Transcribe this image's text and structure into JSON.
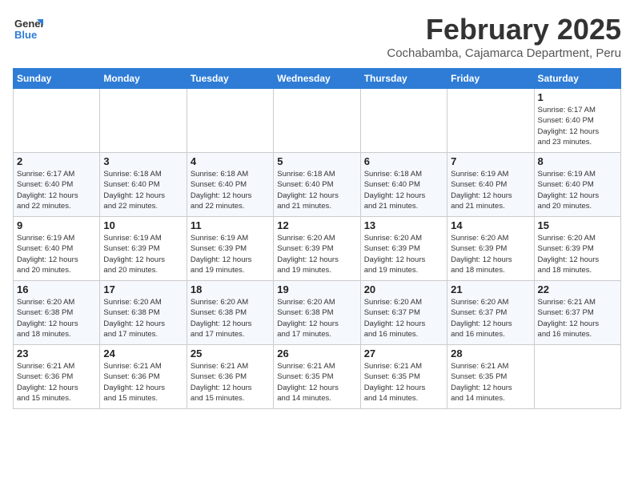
{
  "logo": {
    "general": "General",
    "blue": "Blue"
  },
  "header": {
    "title": "February 2025",
    "subtitle": "Cochabamba, Cajamarca Department, Peru"
  },
  "weekdays": [
    "Sunday",
    "Monday",
    "Tuesday",
    "Wednesday",
    "Thursday",
    "Friday",
    "Saturday"
  ],
  "weeks": [
    [
      {
        "day": "",
        "info": ""
      },
      {
        "day": "",
        "info": ""
      },
      {
        "day": "",
        "info": ""
      },
      {
        "day": "",
        "info": ""
      },
      {
        "day": "",
        "info": ""
      },
      {
        "day": "",
        "info": ""
      },
      {
        "day": "1",
        "info": "Sunrise: 6:17 AM\nSunset: 6:40 PM\nDaylight: 12 hours\nand 23 minutes."
      }
    ],
    [
      {
        "day": "2",
        "info": "Sunrise: 6:17 AM\nSunset: 6:40 PM\nDaylight: 12 hours\nand 22 minutes."
      },
      {
        "day": "3",
        "info": "Sunrise: 6:18 AM\nSunset: 6:40 PM\nDaylight: 12 hours\nand 22 minutes."
      },
      {
        "day": "4",
        "info": "Sunrise: 6:18 AM\nSunset: 6:40 PM\nDaylight: 12 hours\nand 22 minutes."
      },
      {
        "day": "5",
        "info": "Sunrise: 6:18 AM\nSunset: 6:40 PM\nDaylight: 12 hours\nand 21 minutes."
      },
      {
        "day": "6",
        "info": "Sunrise: 6:18 AM\nSunset: 6:40 PM\nDaylight: 12 hours\nand 21 minutes."
      },
      {
        "day": "7",
        "info": "Sunrise: 6:19 AM\nSunset: 6:40 PM\nDaylight: 12 hours\nand 21 minutes."
      },
      {
        "day": "8",
        "info": "Sunrise: 6:19 AM\nSunset: 6:40 PM\nDaylight: 12 hours\nand 20 minutes."
      }
    ],
    [
      {
        "day": "9",
        "info": "Sunrise: 6:19 AM\nSunset: 6:40 PM\nDaylight: 12 hours\nand 20 minutes."
      },
      {
        "day": "10",
        "info": "Sunrise: 6:19 AM\nSunset: 6:39 PM\nDaylight: 12 hours\nand 20 minutes."
      },
      {
        "day": "11",
        "info": "Sunrise: 6:19 AM\nSunset: 6:39 PM\nDaylight: 12 hours\nand 19 minutes."
      },
      {
        "day": "12",
        "info": "Sunrise: 6:20 AM\nSunset: 6:39 PM\nDaylight: 12 hours\nand 19 minutes."
      },
      {
        "day": "13",
        "info": "Sunrise: 6:20 AM\nSunset: 6:39 PM\nDaylight: 12 hours\nand 19 minutes."
      },
      {
        "day": "14",
        "info": "Sunrise: 6:20 AM\nSunset: 6:39 PM\nDaylight: 12 hours\nand 18 minutes."
      },
      {
        "day": "15",
        "info": "Sunrise: 6:20 AM\nSunset: 6:39 PM\nDaylight: 12 hours\nand 18 minutes."
      }
    ],
    [
      {
        "day": "16",
        "info": "Sunrise: 6:20 AM\nSunset: 6:38 PM\nDaylight: 12 hours\nand 18 minutes."
      },
      {
        "day": "17",
        "info": "Sunrise: 6:20 AM\nSunset: 6:38 PM\nDaylight: 12 hours\nand 17 minutes."
      },
      {
        "day": "18",
        "info": "Sunrise: 6:20 AM\nSunset: 6:38 PM\nDaylight: 12 hours\nand 17 minutes."
      },
      {
        "day": "19",
        "info": "Sunrise: 6:20 AM\nSunset: 6:38 PM\nDaylight: 12 hours\nand 17 minutes."
      },
      {
        "day": "20",
        "info": "Sunrise: 6:20 AM\nSunset: 6:37 PM\nDaylight: 12 hours\nand 16 minutes."
      },
      {
        "day": "21",
        "info": "Sunrise: 6:20 AM\nSunset: 6:37 PM\nDaylight: 12 hours\nand 16 minutes."
      },
      {
        "day": "22",
        "info": "Sunrise: 6:21 AM\nSunset: 6:37 PM\nDaylight: 12 hours\nand 16 minutes."
      }
    ],
    [
      {
        "day": "23",
        "info": "Sunrise: 6:21 AM\nSunset: 6:36 PM\nDaylight: 12 hours\nand 15 minutes."
      },
      {
        "day": "24",
        "info": "Sunrise: 6:21 AM\nSunset: 6:36 PM\nDaylight: 12 hours\nand 15 minutes."
      },
      {
        "day": "25",
        "info": "Sunrise: 6:21 AM\nSunset: 6:36 PM\nDaylight: 12 hours\nand 15 minutes."
      },
      {
        "day": "26",
        "info": "Sunrise: 6:21 AM\nSunset: 6:35 PM\nDaylight: 12 hours\nand 14 minutes."
      },
      {
        "day": "27",
        "info": "Sunrise: 6:21 AM\nSunset: 6:35 PM\nDaylight: 12 hours\nand 14 minutes."
      },
      {
        "day": "28",
        "info": "Sunrise: 6:21 AM\nSunset: 6:35 PM\nDaylight: 12 hours\nand 14 minutes."
      },
      {
        "day": "",
        "info": ""
      }
    ]
  ]
}
